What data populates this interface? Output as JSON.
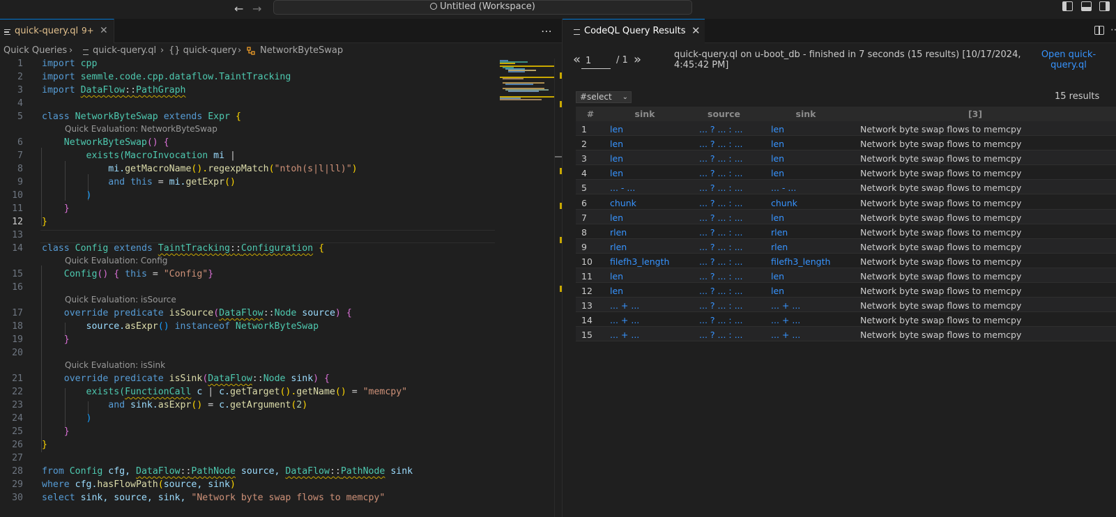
{
  "titlebar": {
    "search_text": "Untitled (Workspace)"
  },
  "editor": {
    "tab": {
      "label": "quick-query.ql",
      "badge": "9+"
    },
    "breadcrumb": {
      "root": "Quick Queries",
      "file": "quick-query.ql",
      "module": "{} quick-query",
      "symbol": "NetworkByteSwap"
    },
    "codelens": {
      "networkbyteswap": "Quick Evaluation: NetworkByteSwap",
      "config": "Quick Evaluation: Config",
      "issource": "Quick Evaluation: isSource",
      "issink": "Quick Evaluation: isSink"
    },
    "line_numbers": [
      "1",
      "2",
      "3",
      "4",
      "5",
      "6",
      "7",
      "8",
      "9",
      "10",
      "11",
      "12",
      "13",
      "14",
      "15",
      "16",
      "17",
      "18",
      "19",
      "20",
      "21",
      "22",
      "23",
      "24",
      "25",
      "26",
      "27",
      "28",
      "29",
      "30"
    ],
    "code": {
      "l1_kw": "import",
      "l1_mod": "cpp",
      "l2_kw": "import",
      "l2_mod": "semmle.code.cpp.dataflow.TaintTracking",
      "l3_kw": "import",
      "l3_a": "DataFlow",
      "l3_sep": "::",
      "l3_b": "PathGraph",
      "l5_kw": "class",
      "l5_name": "NetworkByteSwap",
      "l5_ext": "extends",
      "l5_base": "Expr",
      "l5_brace": "{",
      "l6_fn": "NetworkByteSwap",
      "l6_rest": "() {",
      "l7_kw": "exists(",
      "l7_ty": "MacroInvocation",
      "l7_var": " mi ",
      "l7_bar": "|",
      "l8_var": "mi.",
      "l8_fn": "getMacroName",
      "l8_p": "().",
      "l8_fn2": "regexpMatch",
      "l8_op": "(",
      "l8_str": "\"ntoh(s|l|ll)\"",
      "l8_cl": ")",
      "l9_and": "and",
      "l9_this": "this",
      "l9_eq": " = ",
      "l9_var": "mi.",
      "l9_fn": "getExpr",
      "l9_p": "()",
      "l10": ")",
      "l11": "}",
      "l12": "}",
      "l14_kw": "class",
      "l14_name": "Config",
      "l14_ext": "extends",
      "l14_a": "TaintTracking",
      "l14_sep": "::",
      "l14_b": "Configuration",
      "l14_brace": "{",
      "l15_fn": "Config",
      "l15_p": "() {",
      "l15_this": "this",
      "l15_eq": " = ",
      "l15_str": "\"Config\"",
      "l15_cl": "}",
      "l17_ov": "override",
      "l17_pred": "predicate",
      "l17_fn": "isSource",
      "l17_op": "(",
      "l17_a": "DataFlow",
      "l17_sep": "::",
      "l17_b": "Node",
      "l17_var": " source",
      "l17_cl": ")",
      "l17_brace": " {",
      "l18_var": "source.",
      "l18_fn": "asExpr",
      "l18_p": "()",
      "l18_kw": " instanceof ",
      "l18_ty": "NetworkByteSwap",
      "l19": "}",
      "l21_ov": "override",
      "l21_pred": "predicate",
      "l21_fn": "isSink",
      "l21_op": "(",
      "l21_a": "DataFlow",
      "l21_sep": "::",
      "l21_b": "Node",
      "l21_var": " sink",
      "l21_cl": ")",
      "l21_brace": " {",
      "l22_kw": "exists(",
      "l22_ty": "FunctionCall",
      "l22_var": " c ",
      "l22_bar": "| ",
      "l22_v2": "c.",
      "l22_fn": "getTarget",
      "l22_p": "().",
      "l22_fn2": "getName",
      "l22_p2": "()",
      "l22_eq": " = ",
      "l22_str": "\"memcpy\"",
      "l23_and": "and",
      "l23_var": " sink.",
      "l23_fn": "asExpr",
      "l23_p": "()",
      "l23_eq": " = ",
      "l23_v2": "c.",
      "l23_fn2": "getArgument",
      "l23_op": "(",
      "l23_num": "2",
      "l23_cl": ")",
      "l24": ")",
      "l25": "}",
      "l26": "}",
      "l28_kw": "from",
      "l28_ty": "Config",
      "l28_v1": " cfg, ",
      "l28_a": "DataFlow",
      "l28_sep": "::",
      "l28_b": "PathNode",
      "l28_v2": " source, ",
      "l28_c": "DataFlow",
      "l28_sep2": "::",
      "l28_d": "PathNode",
      "l28_v3": " sink",
      "l29_kw": "where",
      "l29_var": " cfg.",
      "l29_fn": "hasFlowPath",
      "l29_op": "(",
      "l29_args": "source, sink",
      "l29_cl": ")",
      "l30_kw": "select",
      "l30_vars": " sink, source, sink, ",
      "l30_str": "\"Network byte swap flows to memcpy\""
    }
  },
  "results": {
    "tab_label": "CodeQL Query Results",
    "pager_prev": "«",
    "pager_next": "»",
    "page_value": "1",
    "page_total": "/ 1",
    "query_info": "quick-query.ql on u-boot_db - finished in 7 seconds (15 results) [10/17/2024, 4:45:42 PM]",
    "open_link": "Open quick-query.ql",
    "select_value": "#select",
    "result_count": "15 results",
    "columns": [
      "#",
      "sink",
      "source",
      "sink",
      "[3]"
    ],
    "rows": [
      [
        "1",
        "len",
        "... ? ... : ...",
        "len",
        "Network byte swap flows to memcpy"
      ],
      [
        "2",
        "len",
        "... ? ... : ...",
        "len",
        "Network byte swap flows to memcpy"
      ],
      [
        "3",
        "len",
        "... ? ... : ...",
        "len",
        "Network byte swap flows to memcpy"
      ],
      [
        "4",
        "len",
        "... ? ... : ...",
        "len",
        "Network byte swap flows to memcpy"
      ],
      [
        "5",
        "... - ...",
        "... ? ... : ...",
        "... - ...",
        "Network byte swap flows to memcpy"
      ],
      [
        "6",
        "chunk",
        "... ? ... : ...",
        "chunk",
        "Network byte swap flows to memcpy"
      ],
      [
        "7",
        "len",
        "... ? ... : ...",
        "len",
        "Network byte swap flows to memcpy"
      ],
      [
        "8",
        "rlen",
        "... ? ... : ...",
        "rlen",
        "Network byte swap flows to memcpy"
      ],
      [
        "9",
        "rlen",
        "... ? ... : ...",
        "rlen",
        "Network byte swap flows to memcpy"
      ],
      [
        "10",
        "filefh3_length",
        "... ? ... : ...",
        "filefh3_length",
        "Network byte swap flows to memcpy"
      ],
      [
        "11",
        "len",
        "... ? ... : ...",
        "len",
        "Network byte swap flows to memcpy"
      ],
      [
        "12",
        "len",
        "... ? ... : ...",
        "len",
        "Network byte swap flows to memcpy"
      ],
      [
        "13",
        "... + ...",
        "... ? ... : ...",
        "... + ...",
        "Network byte swap flows to memcpy"
      ],
      [
        "14",
        "... + ...",
        "... ? ... : ...",
        "... + ...",
        "Network byte swap flows to memcpy"
      ],
      [
        "15",
        "... + ...",
        "... ? ... : ...",
        "... + ...",
        "Network byte swap flows to memcpy"
      ]
    ]
  },
  "colors": {
    "accent": "#0078d4",
    "link": "#3794ff",
    "warning": "#e2c08d"
  }
}
